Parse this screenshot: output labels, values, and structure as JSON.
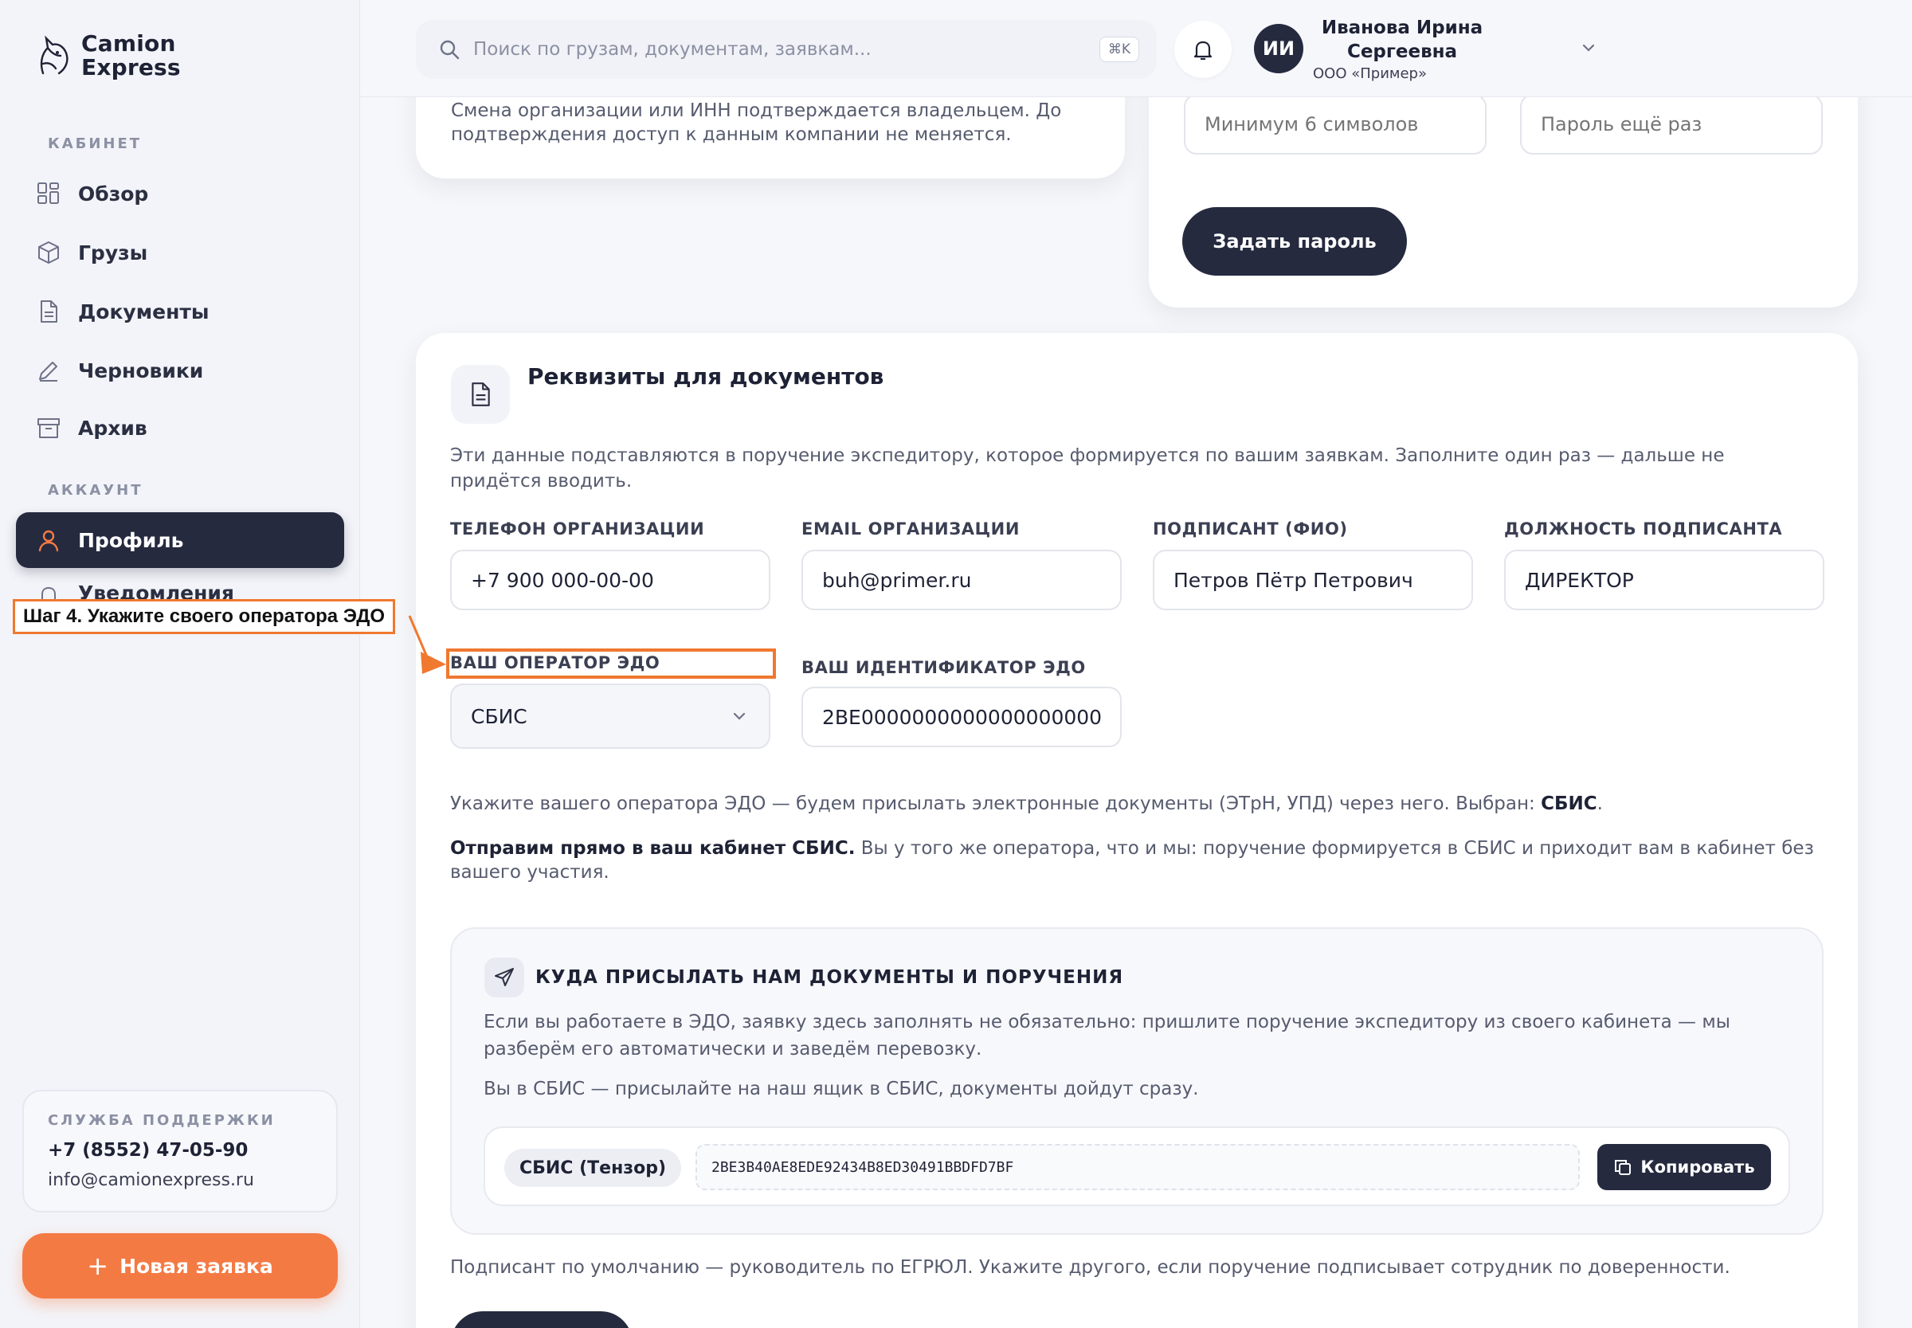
{
  "brand": {
    "line1": "Camion",
    "line2": "Express"
  },
  "sidebar": {
    "section_cabinet": "КАБИНЕТ",
    "section_account": "АККАУНТ",
    "items": [
      {
        "label": "Обзор",
        "icon": "grid-icon"
      },
      {
        "label": "Грузы",
        "icon": "box-icon"
      },
      {
        "label": "Документы",
        "icon": "document-icon"
      },
      {
        "label": "Черновики",
        "icon": "pencil-icon"
      },
      {
        "label": "Архив",
        "icon": "archive-icon"
      }
    ],
    "profile_label": "Профиль",
    "notifications_label": "Уведомления",
    "support": {
      "title": "СЛУЖБА ПОДДЕРЖКИ",
      "phone": "+7 (8552) 47-05-90",
      "email": "info@camionexpress.ru"
    },
    "new_order_label": "Новая заявка"
  },
  "header": {
    "search_placeholder": "Поиск по грузам, документам, заявкам...",
    "shortcut": "⌘K",
    "avatar_initials": "ИИ",
    "user_name": "Иванова Ирина Сергеевна",
    "user_org": "ООО «Пример»"
  },
  "org_card": {
    "text": "Смена организации или ИНН подтверждается владельцем. До подтверждения доступ к данным компании не меняется."
  },
  "password_card": {
    "password_placeholder": "Минимум 6 символов",
    "repeat_placeholder": "Пароль ещё раз",
    "submit_label": "Задать пароль"
  },
  "requisites": {
    "title": "Реквизиты для документов",
    "description": "Эти данные подставляются в поручение экспедитору, которое формируется по вашим заявкам. Заполните один раз — дальше не придётся вводить.",
    "fields": {
      "phone_label": "ТЕЛЕФОН ОРГАНИЗАЦИИ",
      "phone_value": "+7 900 000-00-00",
      "email_label": "EMAIL ОРГАНИЗАЦИИ",
      "email_value": "buh@primer.ru",
      "signer_label": "ПОДПИСАНТ (ФИО)",
      "signer_value": "Петров Пётр Петрович",
      "position_label": "ДОЛЖНОСТЬ ПОДПИСАНТА",
      "position_value": "ДИРЕКТОР",
      "operator_label": "ВАШ ОПЕРАТОР ЭДО",
      "operator_value": "СБИС",
      "edo_id_label": "ВАШ ИДЕНТИФИКАТОР ЭДО",
      "edo_id_value": "2BE0000000000000000000"
    },
    "hint_operator_prefix": "Укажите вашего оператора ЭДО — будем присылать электронные документы (ЭТрН, УПД) через него. Выбран: ",
    "hint_operator_selected": "СБИС",
    "hint_operator_suffix": ".",
    "hint_direct_bold": "Отправим прямо в ваш кабинет СБИС.",
    "hint_direct_text": " Вы у того же оператора, что и мы: поручение формируется в СБИС и приходит вам в кабинет без вашего участия.",
    "send_box": {
      "title": "КУДА ПРИСЫЛАТЬ НАМ ДОКУМЕНТЫ И ПОРУЧЕНИЯ",
      "text1": "Если вы работаете в ЭДО, заявку здесь заполнять не обязательно: пришлите поручение экспедитору из своего кабинета — мы разберём его автоматически и заведём перевозку.",
      "text2": "Вы в СБИС — присылайте на наш ящик в СБИС, документы дойдут сразу.",
      "operator_pill": "СБИС (Тензор)",
      "address_id": "2BE3B40AE8EDE92434B8ED30491BBDFD7BF",
      "copy_label": "Копировать"
    },
    "footer_hint": "Подписант по умолчанию — руководитель по ЕГРЮЛ. Укажите другого, если поручение подписывает сотрудник по доверенности."
  },
  "annotation": {
    "callout": "Шаг 4. Укажите своего оператора ЭДО",
    "color": "#f0782f"
  },
  "colors": {
    "accent": "#f47a44",
    "dark": "#252a3f"
  }
}
